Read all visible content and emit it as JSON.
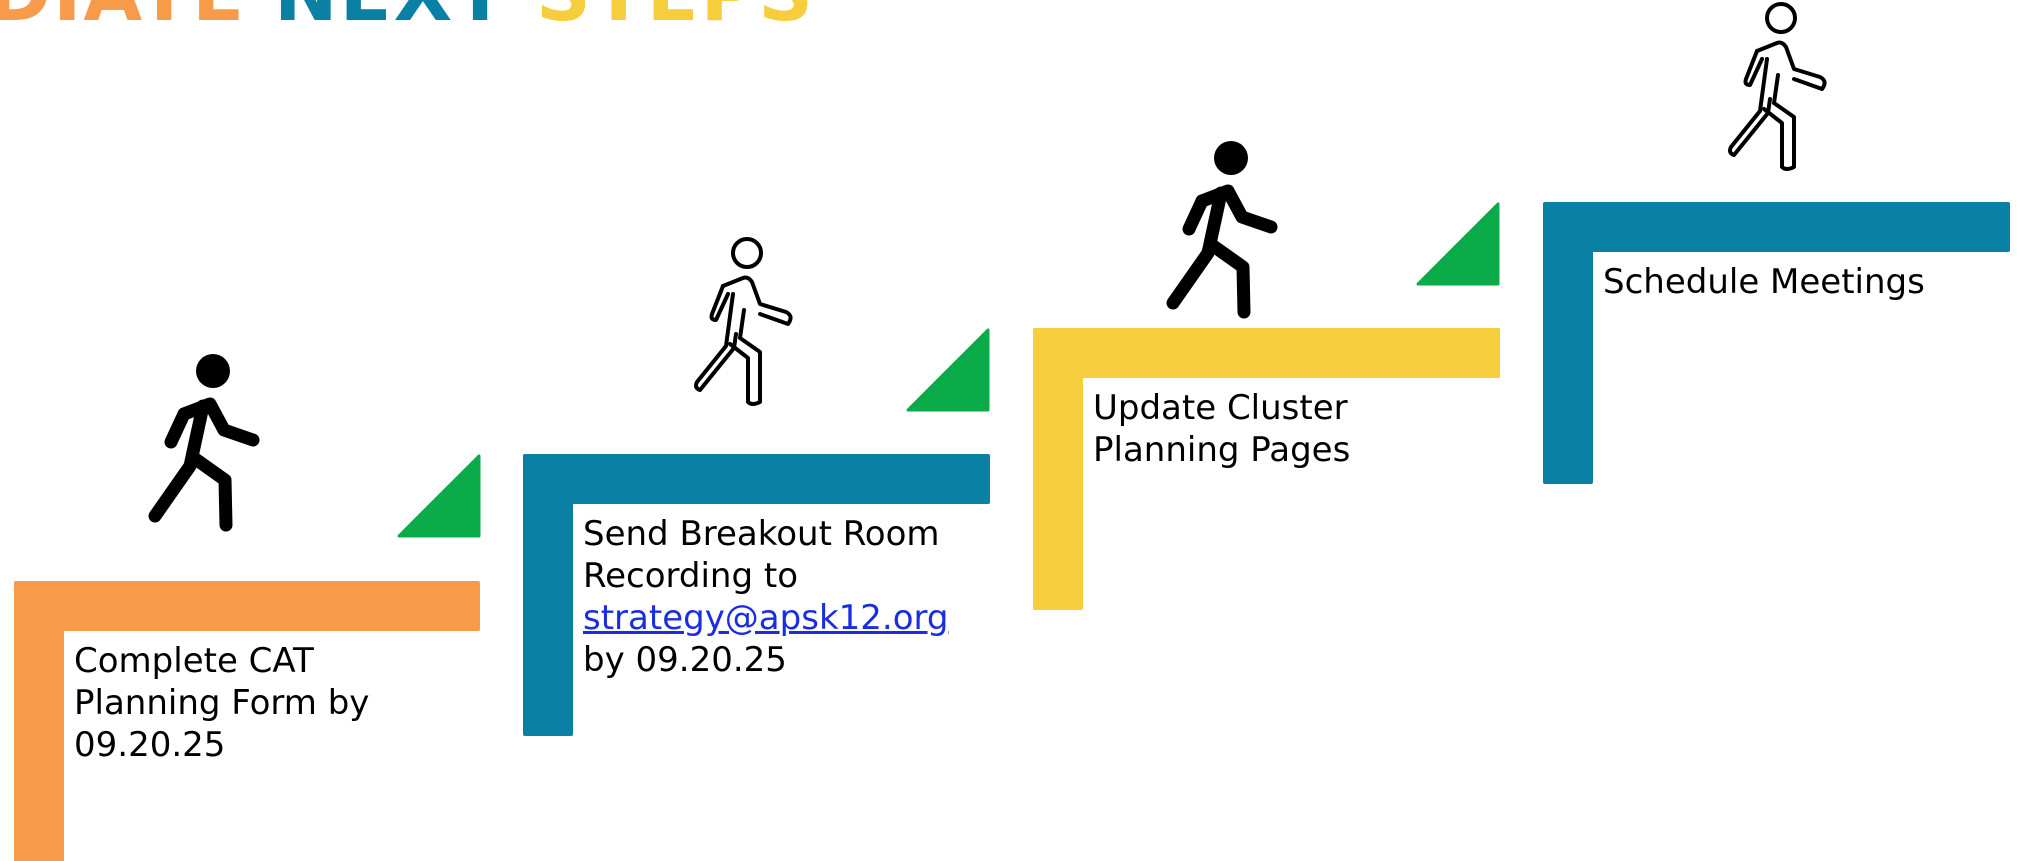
{
  "title": {
    "word1": "DIATE",
    "word2": "NEXT",
    "word3": "STEPS"
  },
  "colors": {
    "orange": "#f79a4a",
    "blue": "#0a80a4",
    "yellow": "#f5cd3d",
    "green": "#0aac4a"
  },
  "steps": [
    {
      "line1": "Complete CAT",
      "line2": "Planning Form by",
      "line3": "09.20.25",
      "icon": "walking-person-filled-icon"
    },
    {
      "line1": "Send Breakout Room",
      "line2": "Recording to",
      "link": "strategy@apsk12.org",
      "line4": "by 09.20.25",
      "icon": "walking-person-outline-icon"
    },
    {
      "line1": "Update Cluster",
      "line2": "Planning Pages",
      "icon": "walking-person-filled-icon"
    },
    {
      "line1": "Schedule Meetings",
      "icon": "walking-person-outline-icon"
    }
  ]
}
